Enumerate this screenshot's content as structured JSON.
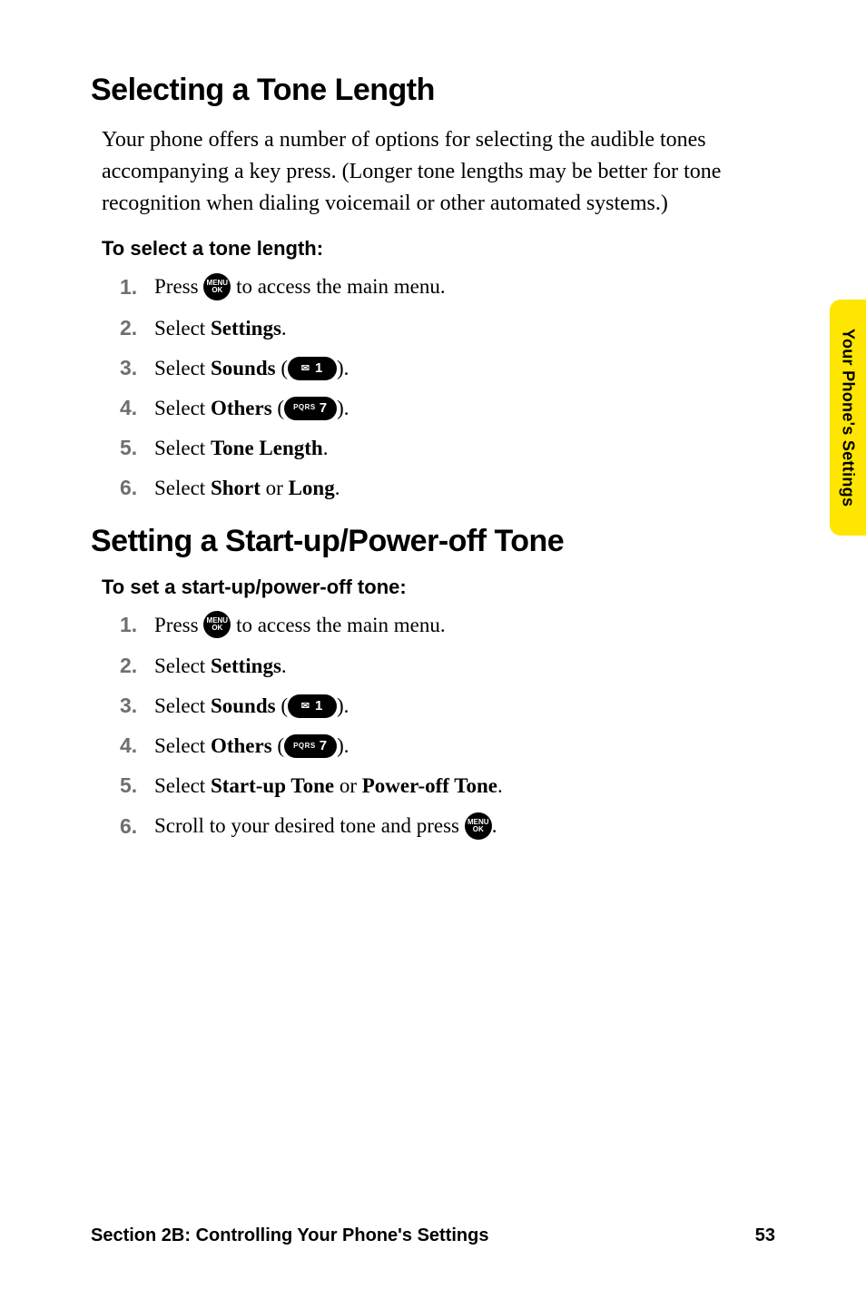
{
  "sideTab": "Your Phone's Settings",
  "footer": {
    "section": "Section 2B: Controlling Your Phone's Settings",
    "page": "53"
  },
  "keys": {
    "menuLine1": "MENU",
    "menuLine2": "OK",
    "one": "1",
    "sevenSub": "PQRS",
    "seven": "7"
  },
  "sec1": {
    "title": "Selecting a Tone Length",
    "intro": "Your phone offers a number of options for selecting the audible tones accompanying a key press. (Longer tone lengths may be better for tone recognition when dialing voicemail or other automated systems.)",
    "sub": "To select a tone length:",
    "s1a": "Press ",
    "s1b": " to access the main menu.",
    "s2a": "Select ",
    "s2b": "Settings",
    "s2c": ".",
    "s3a": "Select ",
    "s3b": "Sounds",
    "s3c": " (",
    "s3d": ").",
    "s4a": "Select ",
    "s4b": "Others",
    "s4c": " (",
    "s4d": ").",
    "s5a": "Select ",
    "s5b": "Tone Length",
    "s5c": ".",
    "s6a": "Select ",
    "s6b": "Short",
    "s6c": " or ",
    "s6d": "Long",
    "s6e": "."
  },
  "sec2": {
    "title": "Setting a Start-up/Power-off Tone",
    "sub": "To set a start-up/power-off tone:",
    "s1a": "Press ",
    "s1b": " to access the main menu.",
    "s2a": "Select ",
    "s2b": "Settings",
    "s2c": ".",
    "s3a": "Select ",
    "s3b": "Sounds",
    "s3c": " (",
    "s3d": ").",
    "s4a": "Select ",
    "s4b": "Others",
    "s4c": " (",
    "s4d": ").",
    "s5a": "Select ",
    "s5b": "Start-up Tone",
    "s5c": " or ",
    "s5d": "Power-off Tone",
    "s5e": ".",
    "s6a": "Scroll to your desired tone and press ",
    "s6b": "."
  }
}
